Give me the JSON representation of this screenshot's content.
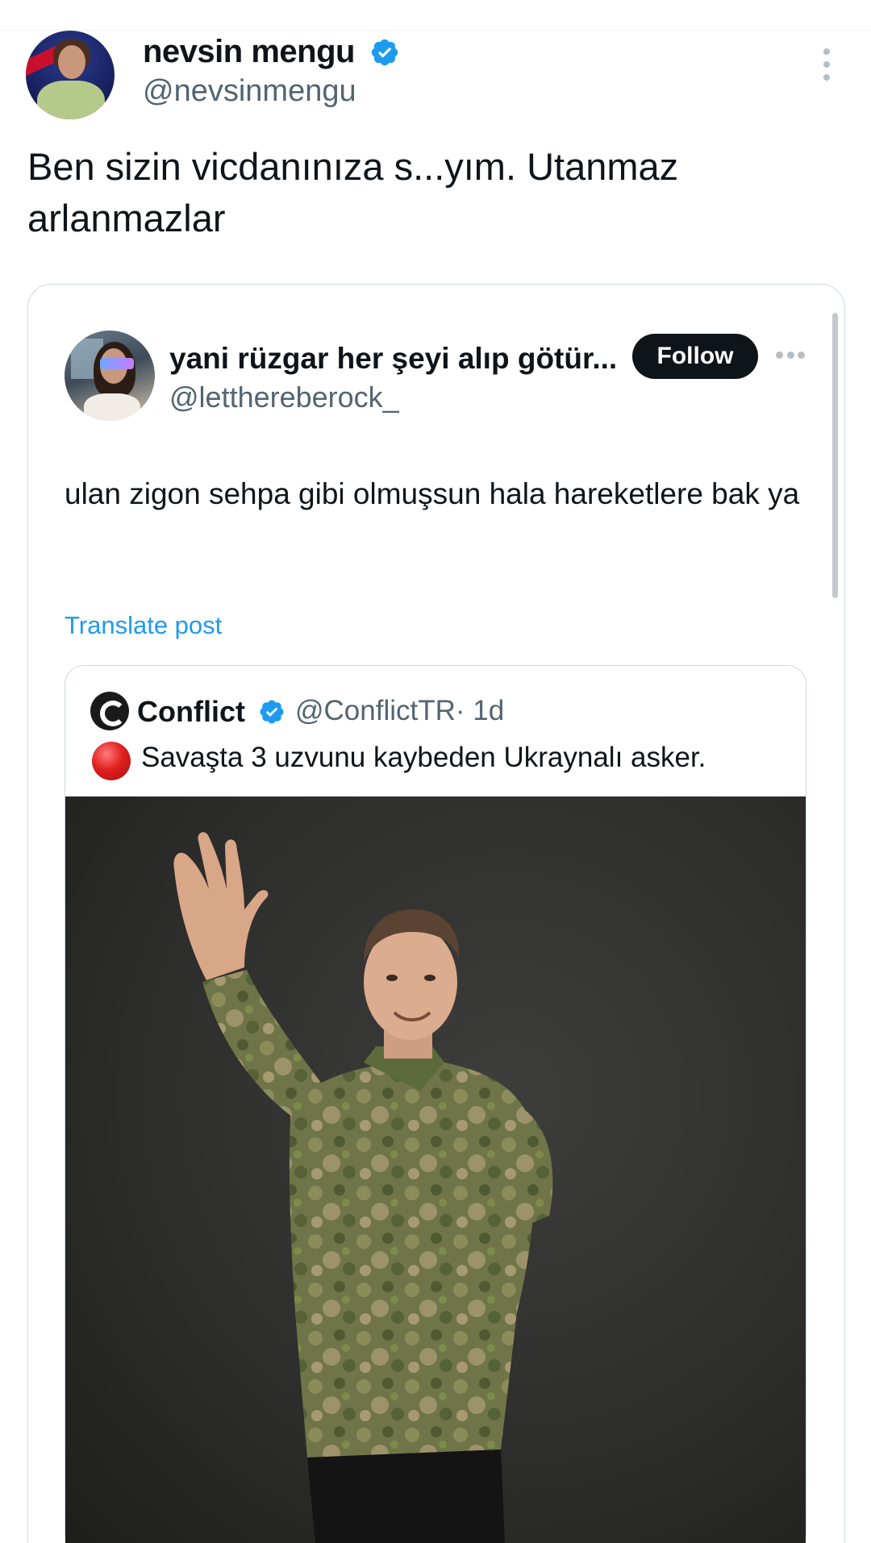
{
  "post": {
    "author_name": "nevsin mengu",
    "author_handle": "@nevsinmengu",
    "text": "Ben sizin vicdanınıza s...yım. Utanmaz arlanmazlar"
  },
  "quoted_post": {
    "author_name": "yani rüzgar her şeyi alıp götür...",
    "author_handle": "@letthereberock_",
    "follow_label": "Follow",
    "text": "ulan zigon sehpa gibi olmuşsun hala hareketlere bak ya",
    "translate_label": "Translate post"
  },
  "embedded_post": {
    "author_name": "Conflict",
    "author_handle": "@ConflictTR",
    "time": "· 1d",
    "text": "Savaşta 3 uzvunu kaybeden Ukraynalı asker."
  },
  "colors": {
    "accent": "#1d9bf0",
    "text_primary": "#0f1419",
    "text_secondary": "#536471",
    "border": "#cfd9de"
  },
  "icons": {
    "verified": "verified-badge-icon",
    "more_vertical": "more-vertical-icon",
    "more_horizontal": "more-horizontal-icon",
    "red_circle": "red-circle-emoji"
  }
}
